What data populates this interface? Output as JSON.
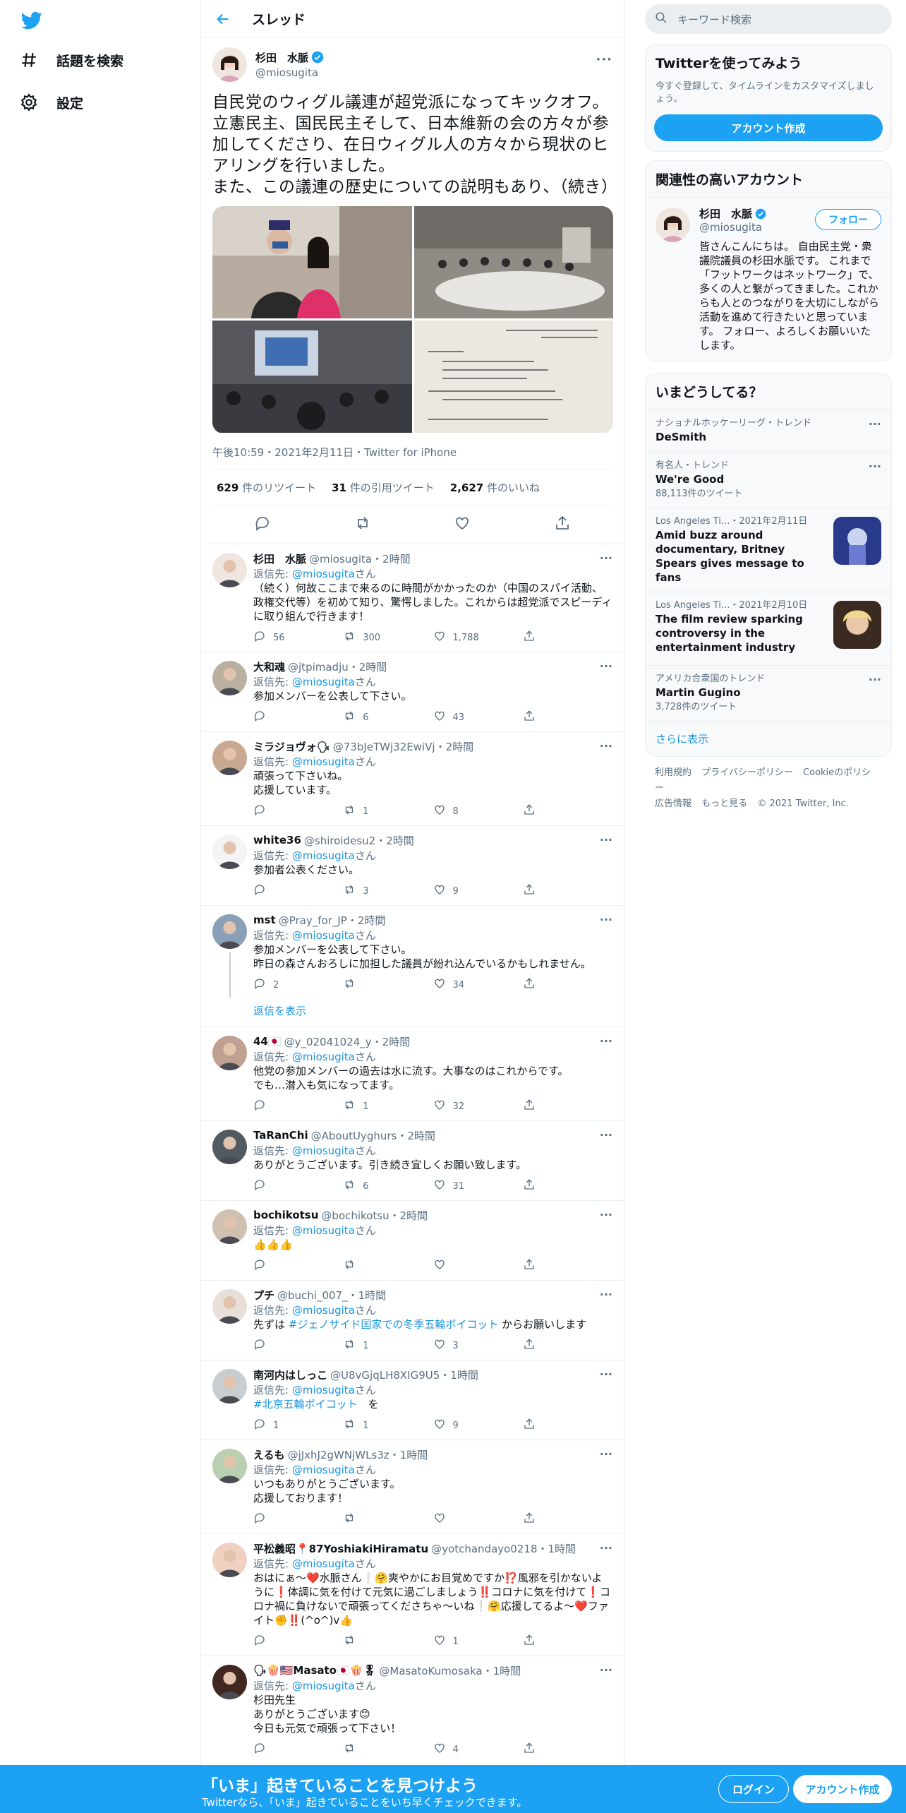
{
  "nav": {
    "explore_label": "話題を検索",
    "settings_label": "設定"
  },
  "header": {
    "title": "スレッド"
  },
  "main_tweet": {
    "name": "杉田　水脈",
    "handle": "@miosugita",
    "text": "自民党のウィグル議連が超党派になってキックオフ。立憲民主、国民民主そして、日本維新の会の方々が参加してくださり、在日ウィグル人の方々から現状のヒアリングを行いました。\nまた、この議連の歴史についての説明もあり、（続き）",
    "meta": "午後10:59・2021年2月11日・Twitter for iPhone",
    "retweets_num": "629",
    "retweets_label": "件のリツイート",
    "quotes_num": "31",
    "quotes_label": "件の引用ツイート",
    "likes_num": "2,627",
    "likes_label": "件のいいね"
  },
  "replies": [
    {
      "name": "杉田　水脈",
      "handle": "@miosugita・2時間",
      "to_prefix": "返信先: ",
      "to_user": "@miosugita",
      "to_suffix": "さん",
      "text": "（続く）何故ここまで来るのに時間がかかったのか（中国のスパイ活動、政権交代等）を初めて知り、驚愕しました。これからは超党派でスピーディに取り組んで行きます！",
      "reply": "56",
      "rt": "300",
      "like": "1,788"
    },
    {
      "name": "大和魂",
      "handle": "@jtpimadju・2時間",
      "to_prefix": "返信先: ",
      "to_user": "@miosugita",
      "to_suffix": "さん",
      "text": "参加メンバーを公表して下さい。",
      "reply": "",
      "rt": "6",
      "like": "43"
    },
    {
      "name": "ミラジョヴォ🗣",
      "handle": "@73bJeTWj32EwiVj・2時間",
      "to_prefix": "返信先: ",
      "to_user": "@miosugita",
      "to_suffix": "さん",
      "text": "頑張って下さいね。\n応援しています。",
      "reply": "",
      "rt": "1",
      "like": "8"
    },
    {
      "name": "white36",
      "handle": "@shiroidesu2・2時間",
      "to_prefix": "返信先: ",
      "to_user": "@miosugita",
      "to_suffix": "さん",
      "text": "参加者公表ください。",
      "reply": "",
      "rt": "3",
      "like": "9"
    },
    {
      "name": "mst",
      "handle": "@Pray_for_JP・2時間",
      "to_prefix": "返信先: ",
      "to_user": "@miosugita",
      "to_suffix": "さん",
      "text": "参加メンバーを公表して下さい。\n昨日の森さんおろしに加担した議員が紛れ込んでいるかもしれません。",
      "reply": "2",
      "rt": "",
      "like": "34",
      "show_replies": "返信を表示"
    },
    {
      "name": "44🇯🇵",
      "handle": "@y_02041024_y・2時間",
      "to_prefix": "返信先: ",
      "to_user": "@miosugita",
      "to_suffix": "さん",
      "text": "他党の参加メンバーの過去は水に流す。大事なのはこれからです。\nでも…潜入も気になってます。",
      "reply": "",
      "rt": "1",
      "like": "32"
    },
    {
      "name": "TaRanChi",
      "handle": "@AboutUyghurs・2時間",
      "to_prefix": "返信先: ",
      "to_user": "@miosugita",
      "to_suffix": "さん",
      "text": "ありがとうございます。引き続き宜しくお願い致します。",
      "reply": "",
      "rt": "6",
      "like": "31"
    },
    {
      "name": "bochikotsu",
      "handle": "@bochikotsu・2時間",
      "to_prefix": "返信先: ",
      "to_user": "@miosugita",
      "to_suffix": "さん",
      "text": "👍👍👍",
      "reply": "",
      "rt": "",
      "like": ""
    },
    {
      "name": "プチ",
      "handle": "@buchi_007_・1時間",
      "to_prefix": "返信先: ",
      "to_user": "@miosugita",
      "to_suffix": "さん",
      "text_pre": "先ずは ",
      "text_link": "#ジェノサイド国家での冬季五輪ボイコット",
      "text_post": " からお願いします",
      "reply": "",
      "rt": "1",
      "like": "3"
    },
    {
      "name": "南河内はしっこ",
      "handle": "@U8vGjqLH8XIG9U5・1時間",
      "to_prefix": "返信先: ",
      "to_user": "@miosugita",
      "to_suffix": "さん",
      "text_pre": "",
      "text_link": "#北京五輪ボイコット",
      "text_post": "　を",
      "reply": "1",
      "rt": "1",
      "like": "9"
    },
    {
      "name": "えるも",
      "handle": "@jJxhJ2gWNjWLs3z・1時間",
      "to_prefix": "返信先: ",
      "to_user": "@miosugita",
      "to_suffix": "さん",
      "text": "いつもありがとうございます。\n応援しております！",
      "reply": "",
      "rt": "",
      "like": ""
    },
    {
      "name": "平松義昭📍87YoshiakiHiramatu",
      "handle": "@yotchandayo0218・1時間",
      "to_prefix": "返信先: ",
      "to_user": "@miosugita",
      "to_suffix": "さん",
      "text": "おはにぁ～❤️水脈さん❕🤗爽やかにお目覚めですか⁉️風邪を引かないように❗️体調に気を付けて元気に過ごしましょう‼️コロナに気を付けて❗️コロナ禍に負けないで頑張ってくださちゃ～いね❕🤗応援してるよ～❤️ファイト✊‼️(^o^)v👍",
      "reply": "",
      "rt": "",
      "like": "1"
    },
    {
      "name": "🗣🍿🇺🇸Masato🇯🇵🍿🎖",
      "handle": "@MasatoKumosaka・1時間",
      "to_prefix": "返信先: ",
      "to_user": "@miosugita",
      "to_suffix": "さん",
      "text": "杉田先生\nありがとうございます😊\n今日も元気で頑張って下さい！",
      "reply": "",
      "rt": "",
      "like": "4"
    }
  ],
  "search": {
    "placeholder": "キーワード検索"
  },
  "join": {
    "title": "Twitterを使ってみよう",
    "subtitle": "今すぐ登録して、タイムラインをカスタマイズしましょう。",
    "button": "アカウント作成"
  },
  "related": {
    "title": "関連性の高いアカウント",
    "name": "杉田　水脈",
    "handle": "@miosugita",
    "follow": "フォロー",
    "bio": "皆さんこんにちは。 自由民主党・衆議院議員の杉田水脈です。 これまで「フットワークはネットワーク」で、多くの人と繋がってきました。これからも人とのつながりを大切にしながら活動を進めて行きたいと思っています。 フォロー、よろしくお願いいたします。"
  },
  "trends": {
    "title": "いまどうしてる？",
    "items": [
      {
        "cat": "ナショナルホッケーリーグ・トレンド",
        "name": "DeSmith",
        "count": ""
      },
      {
        "cat": "有名人・トレンド",
        "name": "We're Good",
        "count": "88,113件のツイート"
      },
      {
        "cat": "Los Angeles Ti...・2021年2月11日",
        "name": "Amid buzz around documentary, Britney Spears gives message to fans",
        "count": ""
      },
      {
        "cat": "Los Angeles Ti...・2021年2月10日",
        "name": "The film review sparking controversy in the entertainment industry",
        "count": ""
      },
      {
        "cat": "アメリカ合衆国のトレンド",
        "name": "Martin Gugino",
        "count": "3,728件のツイート"
      }
    ],
    "show_more": "さらに表示"
  },
  "footer": {
    "terms": "利用規約",
    "privacy": "プライバシーポリシー",
    "cookie": "Cookieのポリシー",
    "ads": "広告情報",
    "more": "もっと見る",
    "copyright": "© 2021 Twitter, Inc."
  },
  "bottombar": {
    "title": "「いま」起きていることを見つけよう",
    "subtitle": "Twitterなら、「いま」起きていることをいち早くチェックできます。",
    "login": "ログイン",
    "signup": "アカウント作成"
  },
  "colors": {
    "accent": "#1da1f2",
    "link": "#1b95e0",
    "text_secondary": "#5b7083"
  }
}
